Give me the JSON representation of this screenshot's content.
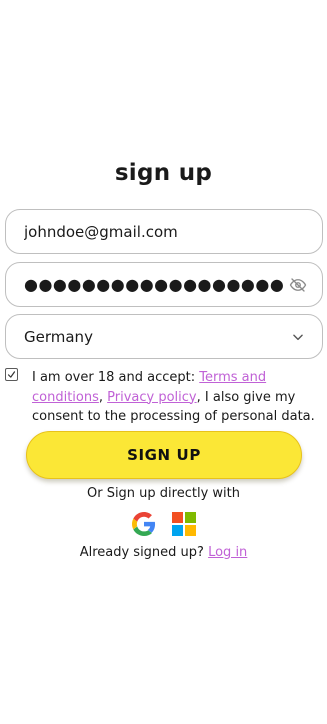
{
  "form": {
    "title": "sign up",
    "email": {
      "value": "johndoe@gmail.com"
    },
    "password": {
      "masked_value": "●●●●●●●●●●●●●●●●●●",
      "toggle_icon": "eye-off-icon"
    },
    "country": {
      "selected": "Germany",
      "icon": "chevron-down-icon"
    },
    "consent": {
      "checked": true,
      "prefix": "I am over 18 and accept: ",
      "terms_link": "Terms and conditions",
      "separator": ", ",
      "privacy_link": "Privacy policy",
      "suffix": ", I also give my consent to the processing of personal data."
    },
    "submit_label": "SIGN UP",
    "alt_signup_text": "Or Sign up directly with",
    "social": [
      "google-icon",
      "microsoft-icon"
    ],
    "login_prompt": "Already signed up?",
    "login_link": "Log in"
  },
  "colors": {
    "button": "#fbe736",
    "link": "#c061d6",
    "border": "#bfbfbf"
  }
}
